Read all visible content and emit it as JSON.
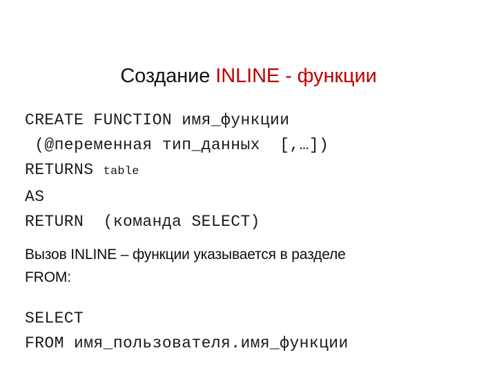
{
  "slide": {
    "background_color": "#FFFFFF",
    "accent_color": "#C00000",
    "text_color": "#111111",
    "title": {
      "plain_part": "Создание ",
      "accent_part": "INLINE - функции",
      "full": "Создание INLINE - функции"
    },
    "syntax_block": {
      "lines": [
        {
          "text": "CREATE FUNCTION имя_функции",
          "small_suffix": ""
        },
        {
          "text": " (@переменная тип_данных  [,…])",
          "small_suffix": ""
        },
        {
          "text": "RETURNS ",
          "small_suffix": "table"
        },
        {
          "text": "AS",
          "small_suffix": ""
        },
        {
          "text": "RETURN  (команда SELECT)",
          "small_suffix": ""
        }
      ]
    },
    "usage_note": {
      "lines": [
        "Вызов INLINE – функции указывается в разделе",
        "FROM:"
      ]
    },
    "usage_block": {
      "lines": [
        "SELECT",
        "FROM имя_пользователя.имя_функции"
      ]
    }
  }
}
